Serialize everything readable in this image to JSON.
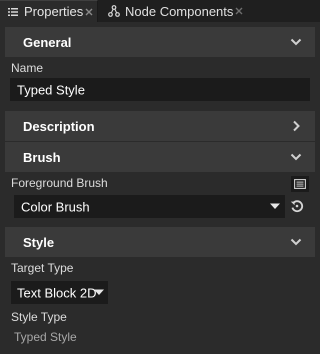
{
  "tabs": [
    {
      "label": "Properties",
      "icon": "properties-list-icon",
      "active": true
    },
    {
      "label": "Node Components",
      "icon": "node-components-icon",
      "active": false
    }
  ],
  "sections": {
    "general": {
      "title": "General",
      "expanded": true,
      "name_label": "Name",
      "name_value": "Typed Style"
    },
    "description": {
      "title": "Description",
      "expanded": false
    },
    "brush": {
      "title": "Brush",
      "expanded": true,
      "foreground_label": "Foreground Brush",
      "foreground_value": "Color Brush"
    },
    "style": {
      "title": "Style",
      "expanded": true,
      "target_type_label": "Target Type",
      "target_type_value": "Text Block 2D",
      "style_type_label": "Style Type",
      "style_type_value": "Typed Style"
    }
  },
  "colors": {
    "background": "#2b2b2b",
    "section_header": "#3a3a3a",
    "field_background": "#1b1b1b",
    "tab_bar": "#1f1f1f"
  }
}
